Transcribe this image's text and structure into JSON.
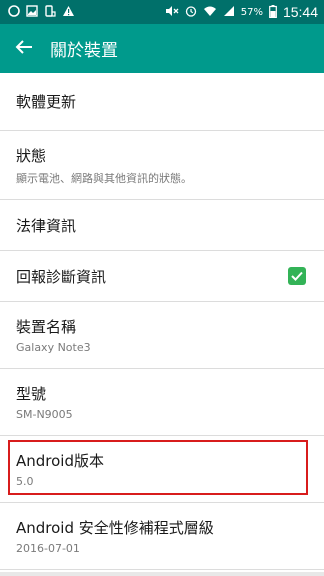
{
  "status_bar": {
    "battery_percent": "57%",
    "time": "15:44",
    "left_icons": [
      "notification-circle-icon",
      "image-icon",
      "phone-transfer-icon",
      "warning-icon"
    ],
    "right_icons": [
      "mute-icon",
      "alarm-icon",
      "wifi-icon",
      "signal-icon",
      "battery-icon"
    ]
  },
  "header": {
    "title": "關於裝置"
  },
  "items": [
    {
      "title": "軟體更新",
      "subtitle": ""
    },
    {
      "title": "狀態",
      "subtitle": "顯示電池、網路與其他資訊的狀態。"
    },
    {
      "title": "法律資訊",
      "subtitle": ""
    },
    {
      "title": "回報診斷資訊",
      "subtitle": "",
      "checked": true
    },
    {
      "title": "裝置名稱",
      "subtitle": "Galaxy Note3"
    },
    {
      "title": "型號",
      "subtitle": "SM-N9005"
    },
    {
      "title": "Android版本",
      "subtitle": "5.0"
    },
    {
      "title": "Android 安全性修補程式層級",
      "subtitle": "2016-07-01"
    }
  ],
  "colors": {
    "status_bar": "#00706a",
    "action_bar": "#009a8c",
    "checkbox": "#33b357",
    "highlight": "#d81c1c"
  }
}
